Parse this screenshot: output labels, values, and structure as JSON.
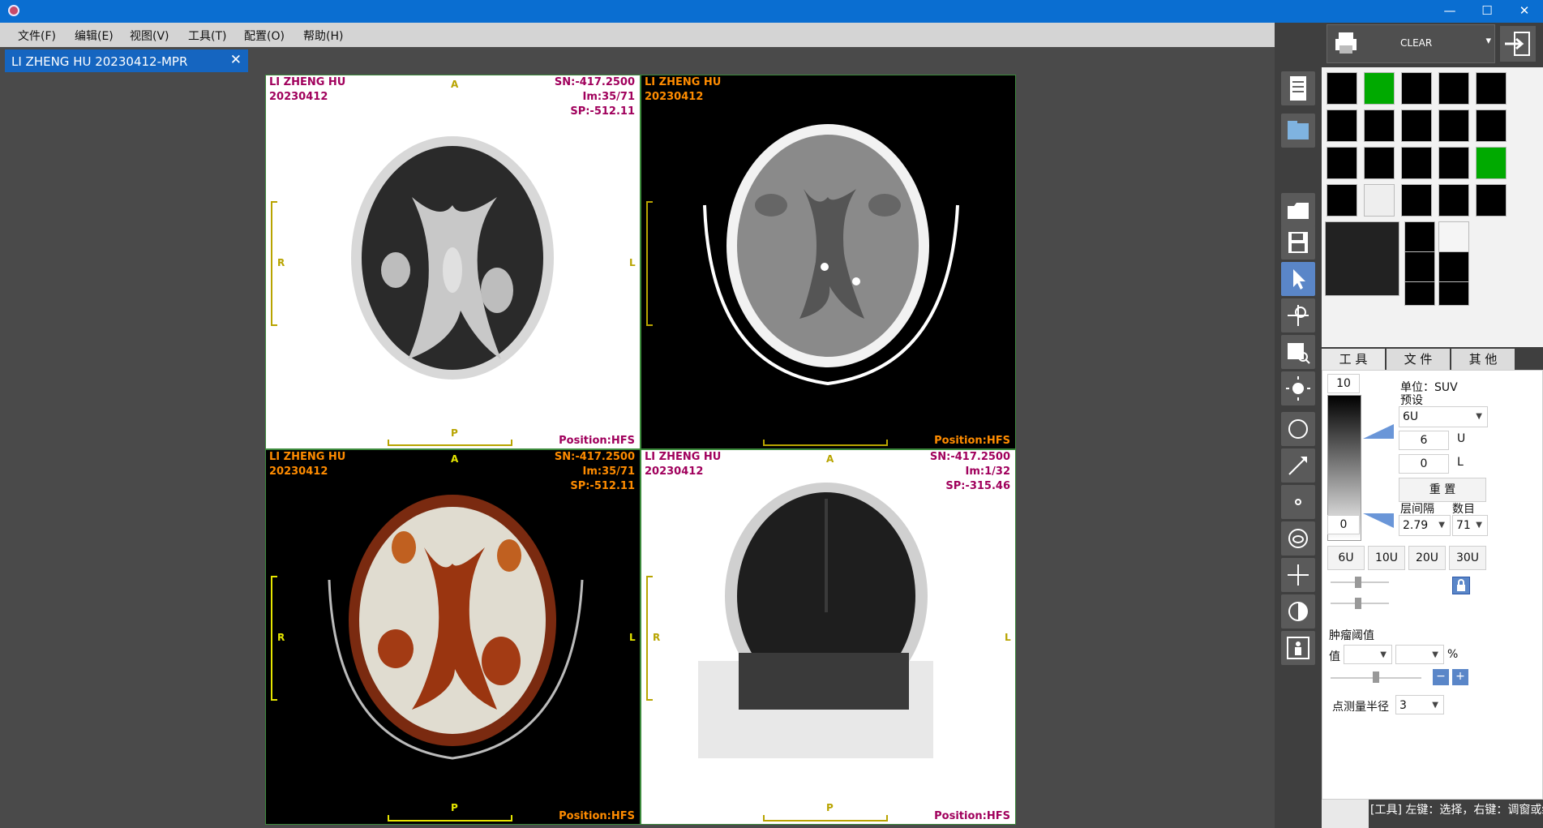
{
  "window": {
    "minimize": "—",
    "maximize": "☐",
    "close": "✕"
  },
  "menu": [
    "文件(F)",
    "编辑(E)",
    "视图(V)",
    "工具(T)",
    "配置(O)",
    "帮助(H)"
  ],
  "tab": {
    "title": "LI ZHENG HU 20230412-MPR",
    "close": "✕"
  },
  "viewports": [
    {
      "patient": "LI ZHENG HU",
      "date": "20230412",
      "sn": "SN:-417.2500",
      "im": "Im:35/71",
      "sp": "SP:-512.11",
      "position": "Position:HFS",
      "a": "A",
      "p": "P",
      "r": "R",
      "l": "L",
      "name_color": "#a0005c",
      "info_color": "#a0005c",
      "dir_color": "#b8a400",
      "bg": "#ffffff"
    },
    {
      "patient": "LI ZHENG HU",
      "date": "20230412",
      "sn": "",
      "im": "",
      "sp": "",
      "position": "Position:HFS",
      "a": "",
      "p": "",
      "r": "",
      "l": "",
      "name_color": "#ff8c00",
      "info_color": "#ff8c00",
      "dir_color": "#b8a400",
      "bg": "#000000"
    },
    {
      "patient": "LI ZHENG HU",
      "date": "20230412",
      "sn": "SN:-417.2500",
      "im": "Im:35/71",
      "sp": "SP:-512.11",
      "position": "Position:HFS",
      "a": "A",
      "p": "P",
      "r": "R",
      "l": "L",
      "name_color": "#ff8c00",
      "info_color": "#ff8c00",
      "dir_color": "#e6e600",
      "bg": "#000000"
    },
    {
      "patient": "LI ZHENG HU",
      "date": "20230412",
      "sn": "SN:-417.2500",
      "im": "Im:1/32",
      "sp": "SP:-315.46",
      "position": "Position:HFS",
      "a": "A",
      "p": "P",
      "r": "R",
      "l": "L",
      "name_color": "#a0005c",
      "info_color": "#a0005c",
      "dir_color": "#b8a400",
      "bg": "#ffffff"
    }
  ],
  "print_bar": {
    "clear_label": "CLEAR",
    "dropdown": "▾"
  },
  "side_tabs": [
    "工 具",
    "文 件",
    "其 他"
  ],
  "tool_panel": {
    "unit_label": "单位：SUV",
    "preset_label": "预设",
    "preset_value": "6U",
    "max_value": "10",
    "min_value": "0",
    "u_value": "6",
    "u_label": "U",
    "l_value": "0",
    "l_label": "L",
    "reset_label": "重 置",
    "spacing_label": "层间隔",
    "count_label": "数目",
    "spacing_value": "2.79",
    "count_value": "71",
    "quick_buttons": [
      "6U",
      "10U",
      "20U",
      "30U"
    ],
    "tumor_label": "肿瘤阈值",
    "value_label": "值",
    "percent_label": "%",
    "minus": "−",
    "plus": "+",
    "radius_label": "点测量半径",
    "radius_value": "3"
  },
  "status_text": "[工具] 左键：选择，右键：调窗或缩放",
  "colors": {
    "titlebar": "#0a6ed1",
    "tab": "#1565c0",
    "active_tool": "#5a86c8",
    "viewport_border": "#3c8a3c"
  }
}
